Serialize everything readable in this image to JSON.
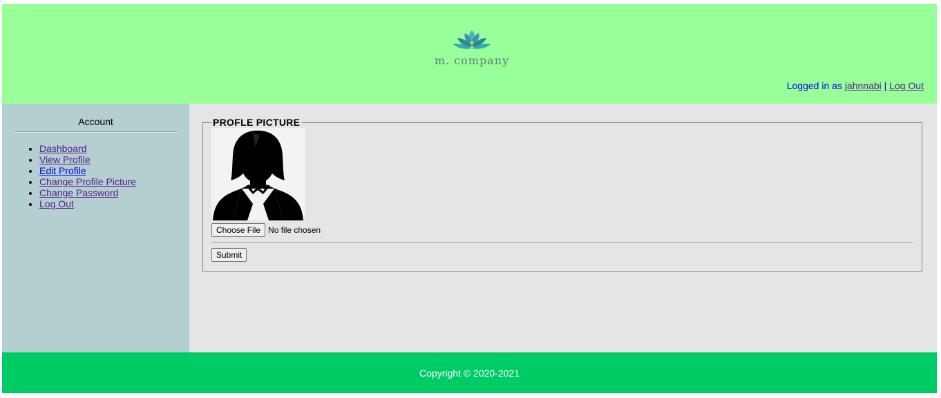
{
  "header": {
    "logo_icon": "lotus-logo-icon",
    "logo_text": "m. company",
    "login_prefix": "Logged in as",
    "username": "jahnnabi",
    "separator": "|",
    "logout_label": "Log Out"
  },
  "sidebar": {
    "title": "Account",
    "items": [
      {
        "label": "Dashboard"
      },
      {
        "label": "View Profile"
      },
      {
        "label": "Edit Profile"
      },
      {
        "label": "Change Profile Picture"
      },
      {
        "label": "Change Password"
      },
      {
        "label": "Log Out"
      }
    ]
  },
  "main": {
    "legend": "PROFLE PICTURE",
    "avatar_icon": "user-avatar-icon",
    "choose_file_label": "Choose File",
    "file_status": "No file chosen",
    "submit_label": "Submit"
  },
  "footer": {
    "copyright": "Copyright © 2020-2021"
  },
  "colors": {
    "header_bg": "#99ff99",
    "sidebar_bg": "#b3cfcf",
    "main_bg": "#e5e5e5",
    "footer_bg": "#00cc66",
    "logo_teal": "#3aa6b0"
  }
}
